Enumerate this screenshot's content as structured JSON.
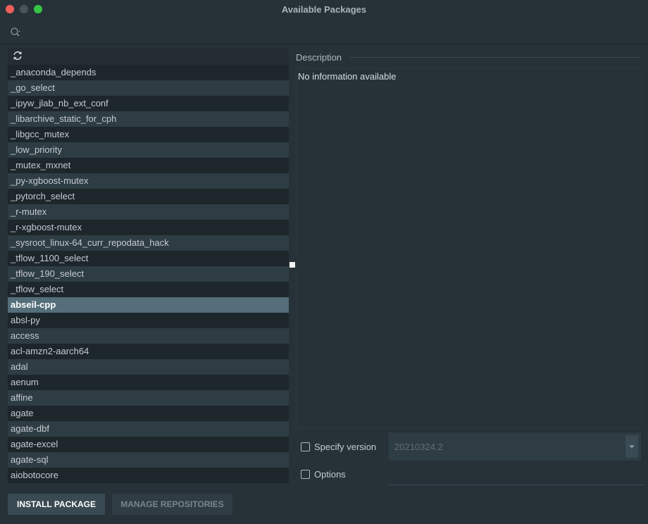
{
  "window": {
    "title": "Available Packages"
  },
  "search": {
    "value": "",
    "placeholder": ""
  },
  "packages": [
    "_anaconda_depends",
    "_go_select",
    "_ipyw_jlab_nb_ext_conf",
    "_libarchive_static_for_cph",
    "_libgcc_mutex",
    "_low_priority",
    "_mutex_mxnet",
    "_py-xgboost-mutex",
    "_pytorch_select",
    "_r-mutex",
    "_r-xgboost-mutex",
    "_sysroot_linux-64_curr_repodata_hack",
    "_tflow_1100_select",
    "_tflow_190_select",
    "_tflow_select",
    "abseil-cpp",
    "absl-py",
    "access",
    "acl-amzn2-aarch64",
    "adal",
    "aenum",
    "affine",
    "agate",
    "agate-dbf",
    "agate-excel",
    "agate-sql",
    "aiobotocore"
  ],
  "selected_package": "abseil-cpp",
  "description": {
    "label": "Description",
    "text": "No information available"
  },
  "specify_version": {
    "label": "Specify version",
    "checked": false,
    "value": "20210324.2"
  },
  "options": {
    "label": "Options",
    "checked": false,
    "value": ""
  },
  "buttons": {
    "install": "INSTALL PACKAGE",
    "manage": "MANAGE REPOSITORIES"
  },
  "icons": {
    "search": "search-icon",
    "refresh": "refresh-icon",
    "dropdown": "chevron-down-icon"
  },
  "colors": {
    "background": "#263238",
    "selected_row": "#546e7a",
    "close": "#ee5f5a",
    "maximize": "#37c545"
  }
}
